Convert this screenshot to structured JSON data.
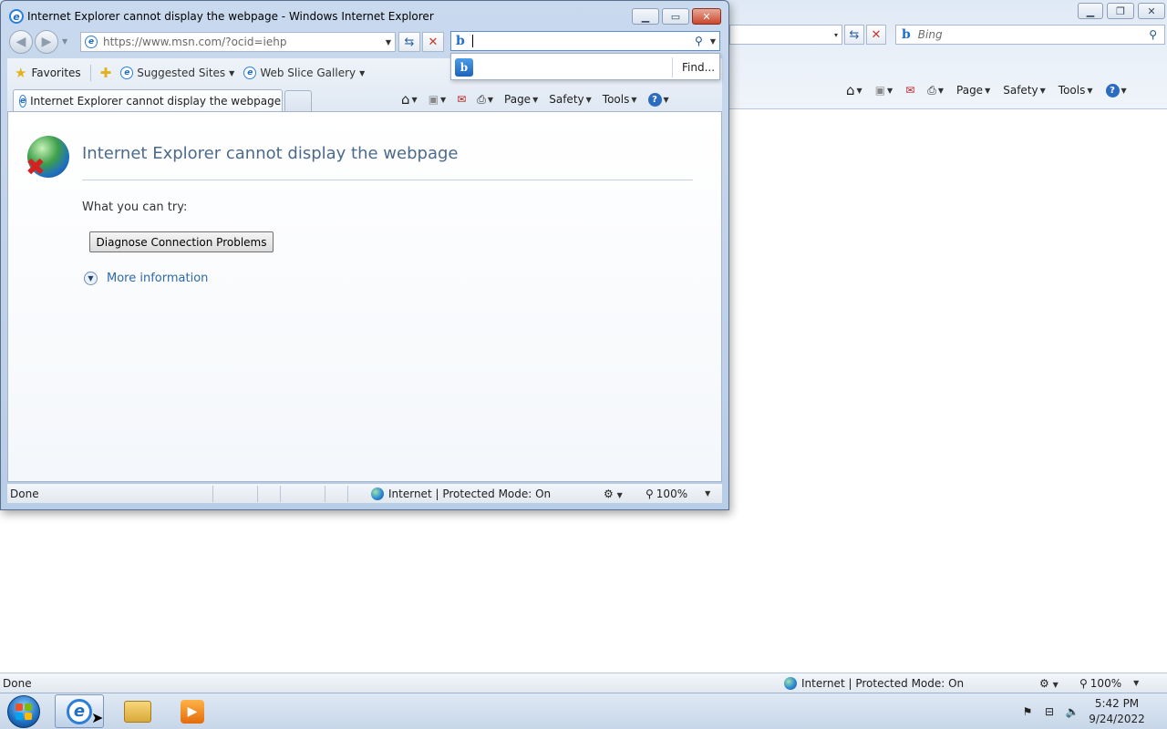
{
  "background_window": {
    "address_dropdown_caret": "▾",
    "search_placeholder": "Bing",
    "command_bar": {
      "page_label": "Page",
      "safety_label": "Safety",
      "tools_label": "Tools"
    },
    "status": {
      "left_text": "Done",
      "zone_text": "Internet | Protected Mode: On",
      "zoom_text": "100%"
    }
  },
  "foreground_window": {
    "title": "Internet Explorer cannot display the webpage - Windows Internet Explorer",
    "address_url": "https://www.msn.com/?ocid=iehp",
    "favorites_bar": {
      "favorites_label": "Favorites",
      "suggested_sites_label": "Suggested Sites",
      "web_slice_gallery_label": "Web Slice Gallery"
    },
    "tab": {
      "label": "Internet Explorer cannot display the webpage"
    },
    "command_bar": {
      "page_label": "Page",
      "safety_label": "Safety",
      "tools_label": "Tools"
    },
    "search": {
      "value": "",
      "find_label": "Find..."
    },
    "content": {
      "heading": "Internet Explorer cannot display the webpage",
      "try_label": "What you can try:",
      "diagnose_button": "Diagnose Connection Problems",
      "more_info_label": "More information"
    },
    "status": {
      "left_text": "Done",
      "zone_text": "Internet | Protected Mode: On",
      "zoom_text": "100%"
    }
  },
  "taskbar": {
    "clock_time": "5:42 PM",
    "clock_date": "9/24/2022",
    "pinned": [
      "internet-explorer",
      "windows-explorer",
      "media-player"
    ]
  },
  "colors": {
    "accent": "#2d6aa8",
    "heading": "#4b6a8c",
    "close_button": "#c9462c"
  }
}
